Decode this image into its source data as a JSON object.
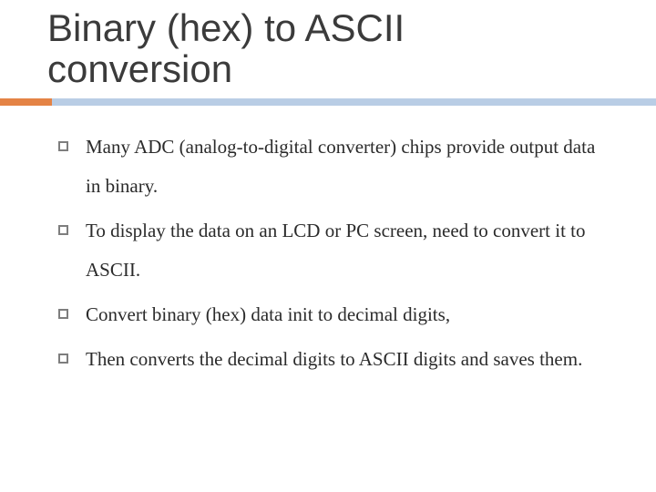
{
  "slide": {
    "title": "Binary (hex) to ASCII conversion",
    "bullets": [
      "Many ADC (analog-to-digital converter) chips provide output data in binary.",
      "To display the data on an LCD or PC screen, need to convert it to ASCII.",
      "Convert binary (hex) data  init to decimal digits,",
      "Then converts the decimal digits to ASCII digits and saves them."
    ]
  },
  "theme": {
    "accent_color": "#e48345",
    "underline_color": "#b9cde5"
  }
}
